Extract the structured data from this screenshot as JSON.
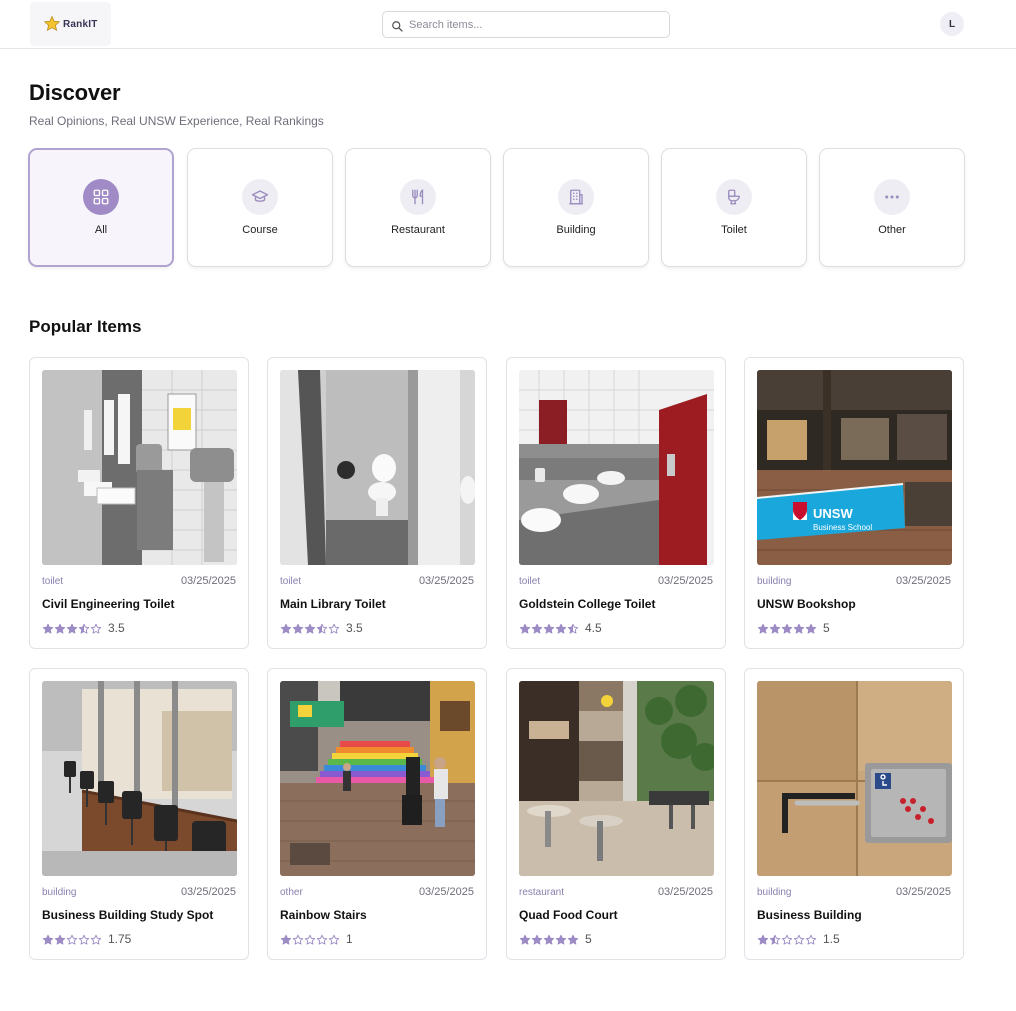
{
  "header": {
    "logo_text": "RankIT",
    "search_placeholder": "Search items...",
    "avatar_initial": "L"
  },
  "page": {
    "title": "Discover",
    "subtitle": "Real Opinions, Real UNSW Experience, Real Rankings"
  },
  "categories": [
    {
      "label": "All",
      "icon": "grid-icon",
      "active": true
    },
    {
      "label": "Course",
      "icon": "graduation-cap-icon",
      "active": false
    },
    {
      "label": "Restaurant",
      "icon": "utensils-icon",
      "active": false
    },
    {
      "label": "Building",
      "icon": "building-icon",
      "active": false
    },
    {
      "label": "Toilet",
      "icon": "toilet-icon",
      "active": false
    },
    {
      "label": "Other",
      "icon": "ellipsis-icon",
      "active": false
    }
  ],
  "popular": {
    "title": "Popular Items",
    "items": [
      {
        "category": "toilet",
        "date": "03/25/2025",
        "title": "Civil Engineering Toilet",
        "rating": 3.5,
        "rating_text": "3.5"
      },
      {
        "category": "toilet",
        "date": "03/25/2025",
        "title": "Main Library Toilet",
        "rating": 3.5,
        "rating_text": "3.5"
      },
      {
        "category": "toilet",
        "date": "03/25/2025",
        "title": "Goldstein College Toilet",
        "rating": 4.5,
        "rating_text": "4.5"
      },
      {
        "category": "building",
        "date": "03/25/2025",
        "title": "UNSW Bookshop",
        "rating": 5,
        "rating_text": "5",
        "sign_text": "UNSW Business School"
      },
      {
        "category": "building",
        "date": "03/25/2025",
        "title": "Business Building Study Spot",
        "rating": 1.75,
        "rating_text": "1.75"
      },
      {
        "category": "other",
        "date": "03/25/2025",
        "title": "Rainbow Stairs",
        "rating": 1,
        "rating_text": "1"
      },
      {
        "category": "restaurant",
        "date": "03/25/2025",
        "title": "Quad Food Court",
        "rating": 5,
        "rating_text": "5"
      },
      {
        "category": "building",
        "date": "03/25/2025",
        "title": "Business Building",
        "rating": 1.5,
        "rating_text": "1.5"
      }
    ]
  },
  "colors": {
    "accent": "#a08bc6",
    "star": "#9c8bc4",
    "border": "#e2e1e7"
  }
}
